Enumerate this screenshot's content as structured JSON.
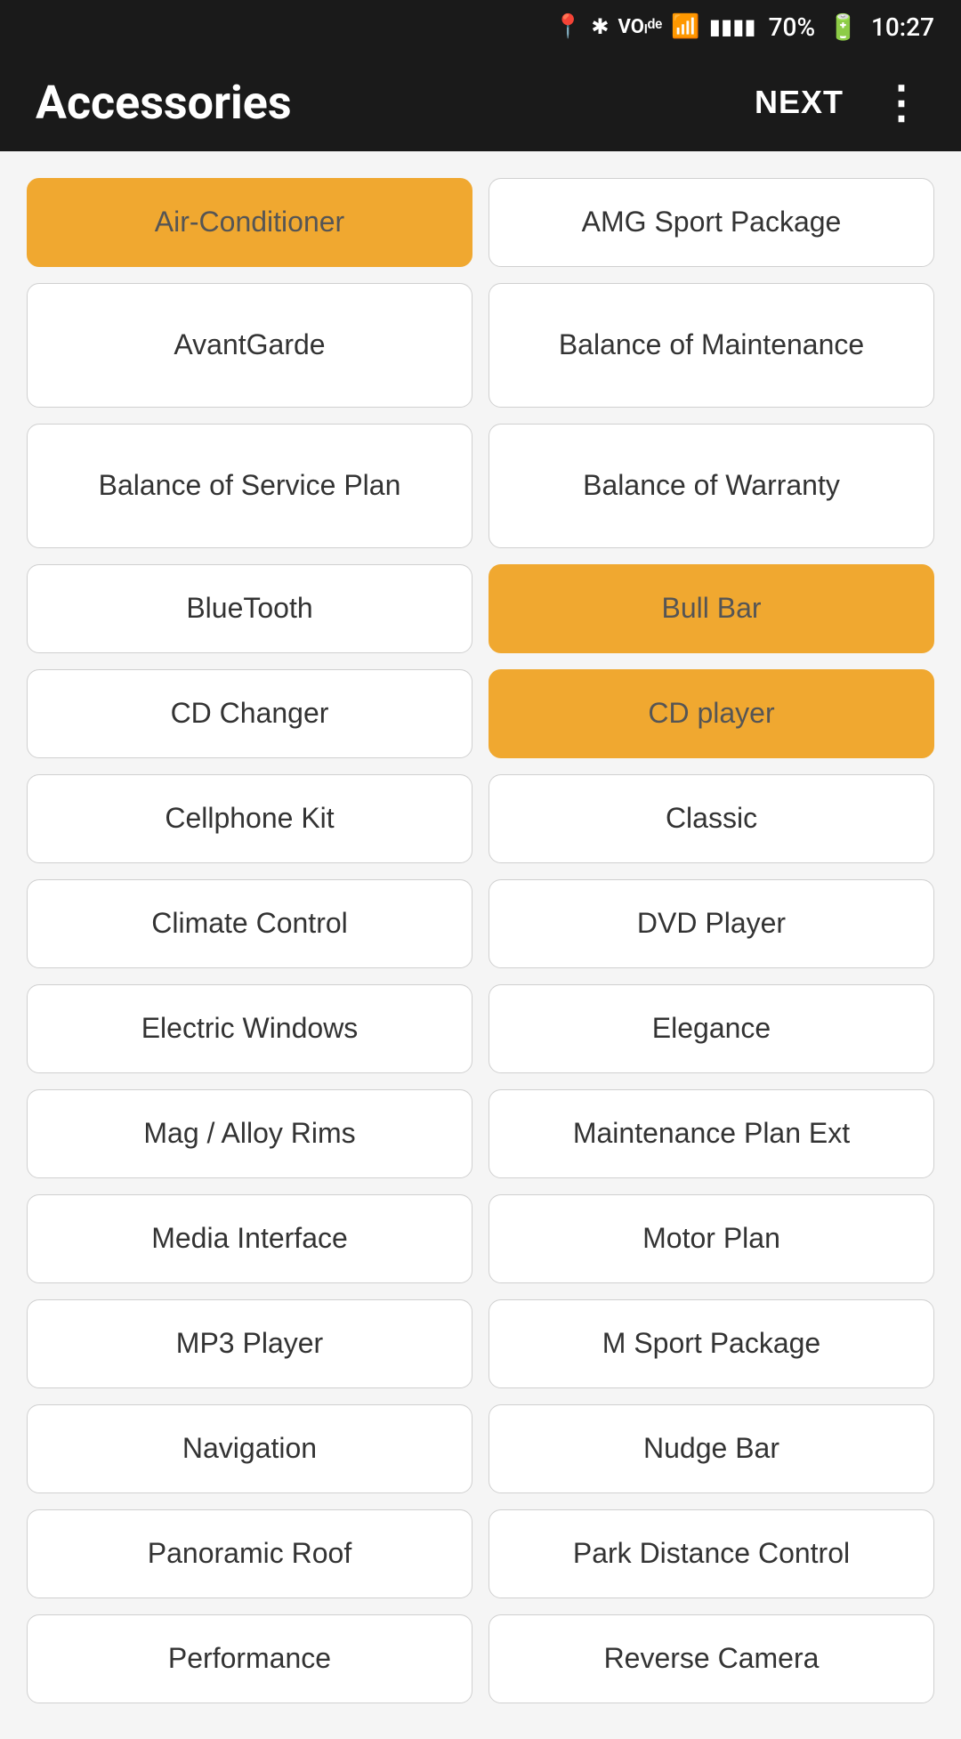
{
  "statusBar": {
    "battery": "70%",
    "time": "10:27"
  },
  "appBar": {
    "title": "Accessories",
    "nextLabel": "NEXT",
    "overflowIcon": "⋮"
  },
  "items": [
    {
      "id": "air-conditioner",
      "label": "Air-Conditioner",
      "selected": true,
      "tall": false
    },
    {
      "id": "amg-sport-package",
      "label": "AMG Sport Package",
      "selected": false,
      "tall": false
    },
    {
      "id": "avantgarde",
      "label": "AvantGarde",
      "selected": false,
      "tall": false
    },
    {
      "id": "balance-of-maintenance",
      "label": "Balance of Maintenance",
      "selected": false,
      "tall": true
    },
    {
      "id": "balance-of-service-plan",
      "label": "Balance of Service Plan",
      "selected": false,
      "tall": true
    },
    {
      "id": "balance-of-warranty",
      "label": "Balance of Warranty",
      "selected": false,
      "tall": false
    },
    {
      "id": "bluetooth",
      "label": "BlueTooth",
      "selected": false,
      "tall": false
    },
    {
      "id": "bull-bar",
      "label": "Bull Bar",
      "selected": true,
      "tall": false
    },
    {
      "id": "cd-changer",
      "label": "CD Changer",
      "selected": false,
      "tall": false
    },
    {
      "id": "cd-player",
      "label": "CD player",
      "selected": true,
      "tall": false
    },
    {
      "id": "cellphone-kit",
      "label": "Cellphone Kit",
      "selected": false,
      "tall": false
    },
    {
      "id": "classic",
      "label": "Classic",
      "selected": false,
      "tall": false
    },
    {
      "id": "climate-control",
      "label": "Climate Control",
      "selected": false,
      "tall": false
    },
    {
      "id": "dvd-player",
      "label": "DVD Player",
      "selected": false,
      "tall": false
    },
    {
      "id": "electric-windows",
      "label": "Electric Windows",
      "selected": false,
      "tall": false
    },
    {
      "id": "elegance",
      "label": "Elegance",
      "selected": false,
      "tall": false
    },
    {
      "id": "mag-alloy-rims",
      "label": "Mag / Alloy Rims",
      "selected": false,
      "tall": false
    },
    {
      "id": "maintenance-plan-ext",
      "label": "Maintenance Plan Ext",
      "selected": false,
      "tall": false
    },
    {
      "id": "media-interface",
      "label": "Media Interface",
      "selected": false,
      "tall": false
    },
    {
      "id": "motor-plan",
      "label": "Motor Plan",
      "selected": false,
      "tall": false
    },
    {
      "id": "mp3-player",
      "label": "MP3 Player",
      "selected": false,
      "tall": false
    },
    {
      "id": "m-sport-package",
      "label": "M Sport Package",
      "selected": false,
      "tall": false
    },
    {
      "id": "navigation",
      "label": "Navigation",
      "selected": false,
      "tall": false
    },
    {
      "id": "nudge-bar",
      "label": "Nudge Bar",
      "selected": false,
      "tall": false
    },
    {
      "id": "panoramic-roof",
      "label": "Panoramic Roof",
      "selected": false,
      "tall": false
    },
    {
      "id": "park-distance-control",
      "label": "Park Distance Control",
      "selected": false,
      "tall": false
    },
    {
      "id": "performance",
      "label": "Performance",
      "selected": false,
      "tall": false
    },
    {
      "id": "reverse-camera",
      "label": "Reverse Camera",
      "selected": false,
      "tall": false
    }
  ]
}
